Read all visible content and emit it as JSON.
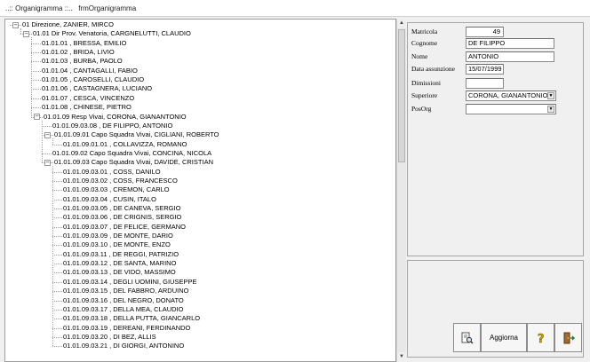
{
  "window": {
    "title": "..:: Organigramma ::..   frmOrganigramma"
  },
  "tree": {
    "nodes": [
      {
        "label": "01 Direzione, ZANIER, MIRCO",
        "expanded": true
      },
      {
        "label": "01.01 Dir Prov. Venatoria, CARGNELUTTI, CLAUDIO",
        "expanded": true
      },
      {
        "label": "01.01.01 , BRESSA, EMILIO"
      },
      {
        "label": "01.01.02 , BRIDA, LIVIO"
      },
      {
        "label": "01.01.03 , BURBA, PAOLO"
      },
      {
        "label": "01.01.04 , CANTAGALLI, FABIO"
      },
      {
        "label": "01.01.05 , CAROSELLI, CLAUDIO"
      },
      {
        "label": "01.01.06 , CASTAGNERA, LUCIANO"
      },
      {
        "label": "01.01.07 , CESCA, VINCENZO"
      },
      {
        "label": "01.01.08 , CHINESE, PIETRO"
      },
      {
        "label": "01.01.09 Resp Vivai, CORONA, GIANANTONIO",
        "expanded": true
      },
      {
        "label": "01.01.09.03.08 , DE FILIPPO, ANTONIO"
      },
      {
        "label": "01.01.09.01 Capo Squadra Vivai, CIGLIANI, ROBERTO",
        "expanded": true
      },
      {
        "label": "01.01.09.01.01 , COLLAVIZZA, ROMANO"
      },
      {
        "label": "01.01.09.02 Capo Squadra Vivai, CONCINA, NICOLA"
      },
      {
        "label": "01.01.09.03 Capo Squadra Vivai, DAVIDE, CRISTIAN",
        "expanded": true
      },
      {
        "label": "01.01.09.03.01 , COSS, DANILO"
      },
      {
        "label": "01.01.09.03.02 , COSS, FRANCESCO"
      },
      {
        "label": "01.01.09.03.03 , CREMON, CARLO"
      },
      {
        "label": "01.01.09.03.04 , CUSIN, ITALO"
      },
      {
        "label": "01.01.09.03.05 , DE CANEVA, SERGIO"
      },
      {
        "label": "01.01.09.03.06 , DE CRIGNIS, SERGIO"
      },
      {
        "label": "01.01.09.03.07 , DE FELICE, GERMANO"
      },
      {
        "label": "01.01.09.03.09 , DE MONTE, DARIO"
      },
      {
        "label": "01.01.09.03.10 , DE MONTE, ENZO"
      },
      {
        "label": "01.01.09.03.11 , DE REGGI, PATRIZIO"
      },
      {
        "label": "01.01.09.03.12 , DE SANTA, MARINO"
      },
      {
        "label": "01.01.09.03.13 , DE VIDO, MASSIMO"
      },
      {
        "label": "01.01.09.03.14 , DEGLI UOMINI, GIUSEPPE"
      },
      {
        "label": "01.01.09.03.15 , DEL FABBRO, ARDUINO"
      },
      {
        "label": "01.01.09.03.16 , DEL NEGRO, DONATO"
      },
      {
        "label": "01.01.09.03.17 , DELLA MEA, CLAUDIO"
      },
      {
        "label": "01.01.09.03.18 , DELLA PUTTA, GIANCARLO"
      },
      {
        "label": "01.01.09.03.19 , DEREANI, FERDINANDO"
      },
      {
        "label": "01.01.09.03.20 , DI BEZ, ALLIS"
      },
      {
        "label": "01.01.09.03.21 , DI GIORGI, ANTONINO"
      }
    ]
  },
  "form": {
    "matricola": {
      "label": "Matricola",
      "value": "49"
    },
    "cognome": {
      "label": "Cognome",
      "value": "DE FILIPPO"
    },
    "nome": {
      "label": "Nome",
      "value": "ANTONIO"
    },
    "data_assunzione": {
      "label": "Data assunzione",
      "value": "15/07/1999"
    },
    "dimissioni": {
      "label": "Dimissioni",
      "value": ""
    },
    "superiore": {
      "label": "Superiore",
      "value": "CORONA, GIANANTONIO"
    },
    "posorg": {
      "label": "PosOrg",
      "value": ""
    }
  },
  "buttons": {
    "preview_icon": "document-magnifier-icon",
    "aggiorna_label": "Aggiorna",
    "help_icon": "question-mark-icon",
    "exit_icon": "door-exit-icon"
  }
}
